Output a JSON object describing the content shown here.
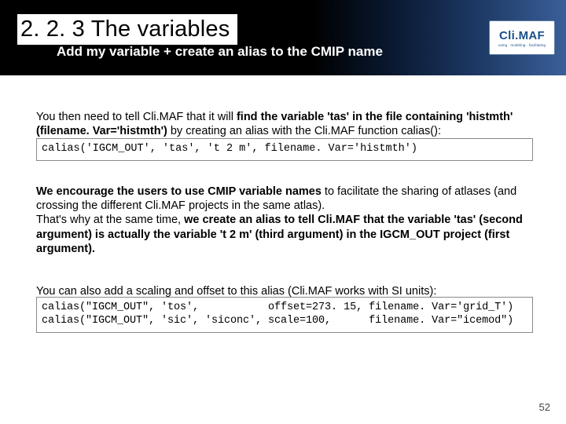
{
  "header": {
    "section_number": "2. 2. 3",
    "section_title": "The variables",
    "subtitle": "Add my variable + create an alias to the CMIP name",
    "logo_name": "Cli.MAF",
    "logo_tag": "using · modeling · facilitating"
  },
  "body": {
    "p1a": "You then need to tell Cli.MAF that it will ",
    "p1b": "find the variable 'tas' in the file containing 'histmth' (filename. Var='histmth')",
    "p1c": " by creating an alias with the Cli.MAF function calias():",
    "code1": "calias('IGCM_OUT', 'tas', 't 2 m', filename. Var='histmth')",
    "p2a": "We encourage the users to use CMIP variable names",
    "p2b": " to facilitate the sharing of atlases (and crossing the different Cli.MAF projects in the same atlas).",
    "p2c": "That's why at the same time, ",
    "p2d": "we create an alias to tell Cli.MAF that the variable 'tas' (second argument) is actually the variable 't 2 m' (third argument) in the IGCM_OUT project (first argument).",
    "p3": "You can also add a scaling and offset to this alias (Cli.MAF works with SI units):",
    "code2": "calias(\"IGCM_OUT\", 'tos',           offset=273. 15, filename. Var='grid_T')\ncalias(\"IGCM_OUT\", 'sic', 'siconc', scale=100,      filename. Var=\"icemod\")"
  },
  "page_number": "52"
}
